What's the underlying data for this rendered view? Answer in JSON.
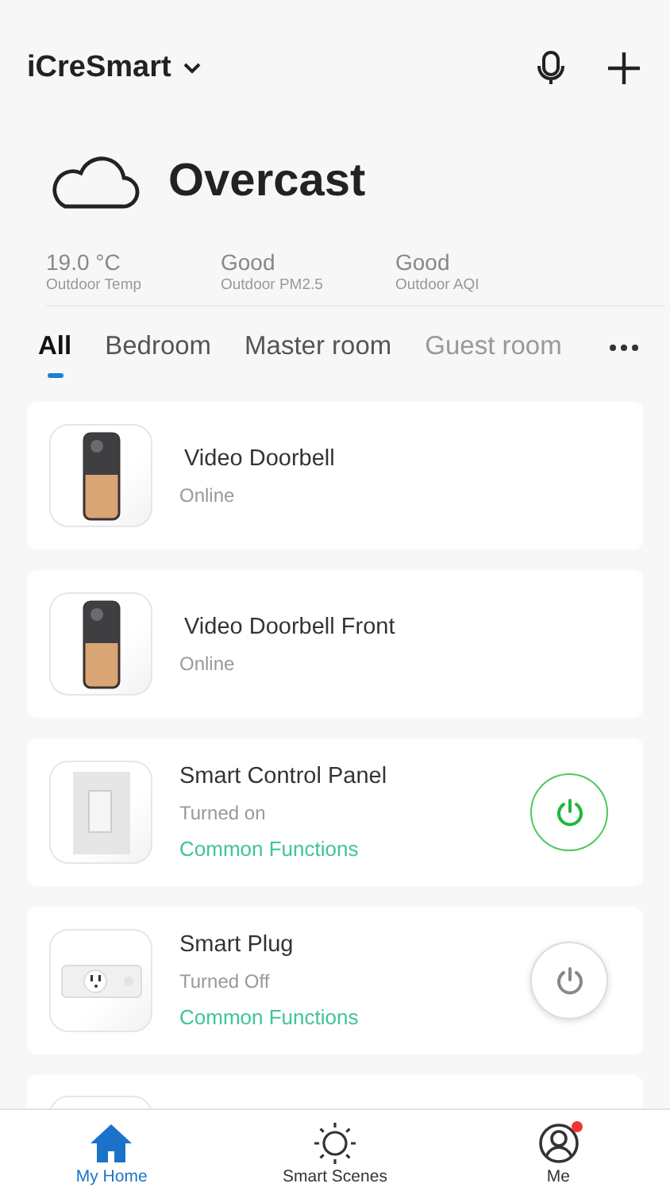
{
  "header": {
    "home_name": "iCreSmart"
  },
  "weather": {
    "condition": "Overcast",
    "stats": [
      {
        "value": "19.0 °C",
        "label": "Outdoor Temp"
      },
      {
        "value": "Good",
        "label": "Outdoor PM2.5"
      },
      {
        "value": "Good",
        "label": "Outdoor AQI"
      }
    ]
  },
  "room_tabs": [
    {
      "label": "All",
      "selected": true
    },
    {
      "label": "Bedroom",
      "selected": false
    },
    {
      "label": "Master room",
      "selected": false
    },
    {
      "label": "Guest room",
      "selected": false
    }
  ],
  "devices": [
    {
      "kind": "doorbell",
      "name": "Video Doorbell",
      "status": "Online"
    },
    {
      "kind": "doorbell",
      "name": "Video Doorbell Front",
      "status": "Online"
    },
    {
      "kind": "switch",
      "name": "Smart Control Panel",
      "status": "Turned on",
      "link": "Common Functions",
      "on": true
    },
    {
      "kind": "plug",
      "name": "Smart Plug",
      "status": "Turned Off",
      "link": "Common Functions",
      "on": false
    },
    {
      "kind": "partial"
    }
  ],
  "bottom_nav": [
    {
      "label": "My Home",
      "kind": "home",
      "selected": true,
      "badge": false
    },
    {
      "label": "Smart Scenes",
      "kind": "scenes",
      "selected": false,
      "badge": false
    },
    {
      "label": "Me",
      "kind": "me",
      "selected": false,
      "badge": true
    }
  ]
}
